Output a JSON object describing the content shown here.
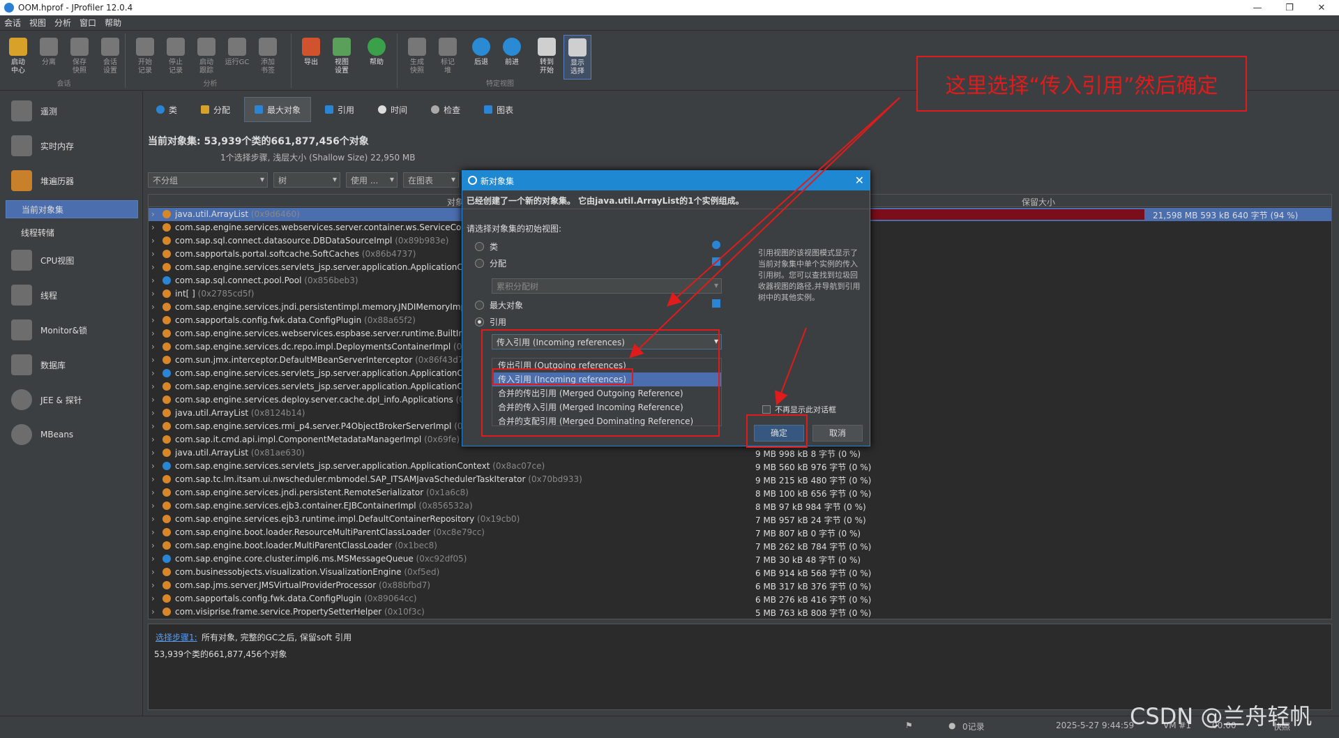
{
  "window": {
    "title": "OOM.hprof - JProfiler 12.0.4",
    "minimize": "—",
    "restore": "❐",
    "close": "✕"
  },
  "menu": [
    "会话",
    "视图",
    "分析",
    "窗口",
    "帮助"
  ],
  "toolbar": {
    "buttons": [
      {
        "label": "启动\n中心"
      },
      {
        "label": "分离"
      },
      {
        "label": "保存\n快照"
      },
      {
        "label": "会话\n设置"
      },
      {
        "label": "开始\n记录"
      },
      {
        "label": "停止\n记录"
      },
      {
        "label": "启动\n跟踪"
      },
      {
        "label": "运行GC"
      },
      {
        "label": "添加\n书签"
      },
      {
        "label": "导出"
      },
      {
        "label": "视图\n设置"
      },
      {
        "label": "帮助"
      },
      {
        "label": "生成\n快照"
      },
      {
        "label": "标记\n堆"
      },
      {
        "label": "后退"
      },
      {
        "label": "前进"
      },
      {
        "label": "转到\n开始"
      },
      {
        "label": "显示\n选择"
      }
    ],
    "groups": {
      "session": "会话",
      "analysis": "分析",
      "view": "特定视图"
    }
  },
  "sidebar": {
    "items": [
      "遥测",
      "实时内存",
      "堆遍历器",
      "CPU视图",
      "线程",
      "Monitor&锁",
      "数据库",
      "JEE & 探针",
      "MBeans"
    ],
    "subitems": [
      "当前对象集",
      "线程转储"
    ]
  },
  "tabs": [
    "类",
    "分配",
    "最大对象",
    "引用",
    "时间",
    "检查",
    "图表"
  ],
  "header": {
    "title": "当前对象集:   53,939个类的661,877,456个对象",
    "subtitle": "1个选择步骤, 浅层大小 (Shallow Size) 22,950 MB"
  },
  "filters": {
    "group": "不分组",
    "view": "树",
    "use": "使用 ...",
    "show_graph": "在图表"
  },
  "table": {
    "col_object": "对象",
    "col_retained": "保留大小",
    "rows": [
      {
        "name": "java.util.ArrayList",
        "id": "(0x9d6460)",
        "size": "21,598 MB 593 kB 640 字节 (94 %)"
      },
      {
        "name": "com.sap.engine.services.webservices.server.container.ws.ServiceContex",
        "id": "",
        "size": ""
      },
      {
        "name": "com.sap.sql.connect.datasource.DBDataSourceImpl",
        "id": "(0x89b983e)",
        "size": ""
      },
      {
        "name": "com.sapportals.portal.softcache.SoftCaches",
        "id": "(0x86b4737)",
        "size": ""
      },
      {
        "name": "com.sap.engine.services.servlets_jsp.server.application.ApplicationCont",
        "id": "",
        "size": ""
      },
      {
        "name": "com.sap.sql.connect.pool.Pool",
        "id": "(0x856beb3)",
        "size": ""
      },
      {
        "name": "int[ ]",
        "id": "(0x2785cd5f)",
        "size": ""
      },
      {
        "name": "com.sap.engine.services.jndi.persistentimpl.memory.JNDIMemoryImpl",
        "id": "",
        "size": ""
      },
      {
        "name": "com.sapportals.config.fwk.data.ConfigPlugin",
        "id": "(0x88a65f2)",
        "size": ""
      },
      {
        "name": "com.sap.engine.services.webservices.espbase.server.runtime.BuiltInWS",
        "id": "",
        "size": ""
      },
      {
        "name": "com.sap.engine.services.dc.repo.impl.DeploymentsContainerImpl",
        "id": "(0x89",
        "size": ""
      },
      {
        "name": "com.sun.jmx.interceptor.DefaultMBeanServerInterceptor",
        "id": "(0x86f43d7)",
        "size": ""
      },
      {
        "name": "com.sap.engine.services.servlets_jsp.server.application.ApplicationCont",
        "id": "",
        "size": ""
      },
      {
        "name": "com.sap.engine.services.servlets_jsp.server.application.ApplicationCont",
        "id": "",
        "size": ""
      },
      {
        "name": "com.sap.engine.services.deploy.server.cache.dpl_info.Applications",
        "id": "(0x1",
        "size": ""
      },
      {
        "name": "java.util.ArrayList",
        "id": "(0x8124b14)",
        "size": ""
      },
      {
        "name": "com.sap.engine.services.rmi_p4.server.P4ObjectBrokerServerImpl",
        "id": "(0x8",
        "size": ""
      },
      {
        "name": "com.sap.it.cmd.api.impl.ComponentMetadataManagerImpl",
        "id": "(0x69fe)",
        "size": ""
      },
      {
        "name": "java.util.ArrayList",
        "id": "(0x81ae630)",
        "size": "9 MB 998 kB 8 字节 (0 %)"
      },
      {
        "name": "com.sap.engine.services.servlets_jsp.server.application.ApplicationContext",
        "id": "(0x8ac07ce)",
        "size": "9 MB 560 kB 976 字节 (0 %)"
      },
      {
        "name": "com.sap.tc.lm.itsam.ui.nwscheduler.mbmodel.SAP_ITSAMJavaSchedulerTaskIterator",
        "id": "(0x70bd933)",
        "size": "9 MB 215 kB 480 字节 (0 %)"
      },
      {
        "name": "com.sap.engine.services.jndi.persistent.RemoteSerializator",
        "id": "(0x1a6c8)",
        "size": "8 MB 100 kB 656 字节 (0 %)"
      },
      {
        "name": "com.sap.engine.services.ejb3.container.EJBContainerImpl",
        "id": "(0x856532a)",
        "size": "8 MB 97 kB 984 字节 (0 %)"
      },
      {
        "name": "com.sap.engine.services.ejb3.runtime.impl.DefaultContainerRepository",
        "id": "(0x19cb0)",
        "size": "7 MB 957 kB 24 字节 (0 %)"
      },
      {
        "name": "com.sap.engine.boot.loader.ResourceMultiParentClassLoader",
        "id": "(0xc8e79cc)",
        "size": "7 MB 807 kB 0 字节 (0 %)"
      },
      {
        "name": "com.sap.engine.boot.loader.MultiParentClassLoader",
        "id": "(0x1bec8)",
        "size": "7 MB 262 kB 784 字节 (0 %)"
      },
      {
        "name": "com.sap.engine.core.cluster.impl6.ms.MSMessageQueue",
        "id": "(0xc92df05)",
        "size": "7 MB 30 kB 48 字节 (0 %)"
      },
      {
        "name": "com.businessobjects.visualization.VisualizationEngine",
        "id": "(0xf5ed)",
        "size": "6 MB 914 kB 568 字节 (0 %)"
      },
      {
        "name": "com.sap.jms.server.JMSVirtualProviderProcessor",
        "id": "(0x88bfbd7)",
        "size": "6 MB 317 kB 376 字节 (0 %)"
      },
      {
        "name": "com.sapportals.config.fwk.data.ConfigPlugin",
        "id": "(0x89064cc)",
        "size": "6 MB 276 kB 416 字节 (0 %)"
      },
      {
        "name": "com.visiprise.frame.service.PropertySetterHelper",
        "id": "(0x10f3c)",
        "size": "5 MB 763 kB 808 字节 (0 %)"
      }
    ]
  },
  "bottom": {
    "step_link": "选择步骤1:",
    "step_text": "所有对象, 完整的GC之后, 保留soft 引用",
    "count": "53,939个类的661,877,456个对象"
  },
  "status": {
    "records": "0记录",
    "datetime": "2025-5-27 9:44:59",
    "vm": "VM #1",
    "time": "00:00",
    "mode": "快照"
  },
  "dialog": {
    "title": "新对象集",
    "created": "已经创建了一个新的对象集。 它由java.util.ArrayList的1个实例组成。",
    "prompt": "请选择对象集的初始视图:",
    "opt_class": "类",
    "opt_alloc": "分配",
    "alloc_combo": "累积分配树",
    "opt_biggest": "最大对象",
    "opt_ref": "引用",
    "ref_combo": "传入引用 (Incoming references)",
    "dropdown": [
      "传出引用 (Outgoing references)",
      "传入引用 (Incoming references)",
      "合并的传出引用 (Merged Outgoing Reference)",
      "合并的传入引用 (Merged Incoming Reference)",
      "合并的支配引用 (Merged Dominating Reference)"
    ],
    "help": "引用视图的该视图模式显示了当前对象集中单个实例的传入引用树。您可以查找到垃圾回收器视图的路径,并导航到引用树中的其他实例。",
    "dont_show": "不再显示此对话框",
    "ok": "确定",
    "cancel": "取消"
  },
  "annotation": "这里选择“传入引用”然后确定",
  "watermark": "CSDN @兰舟轻帆"
}
